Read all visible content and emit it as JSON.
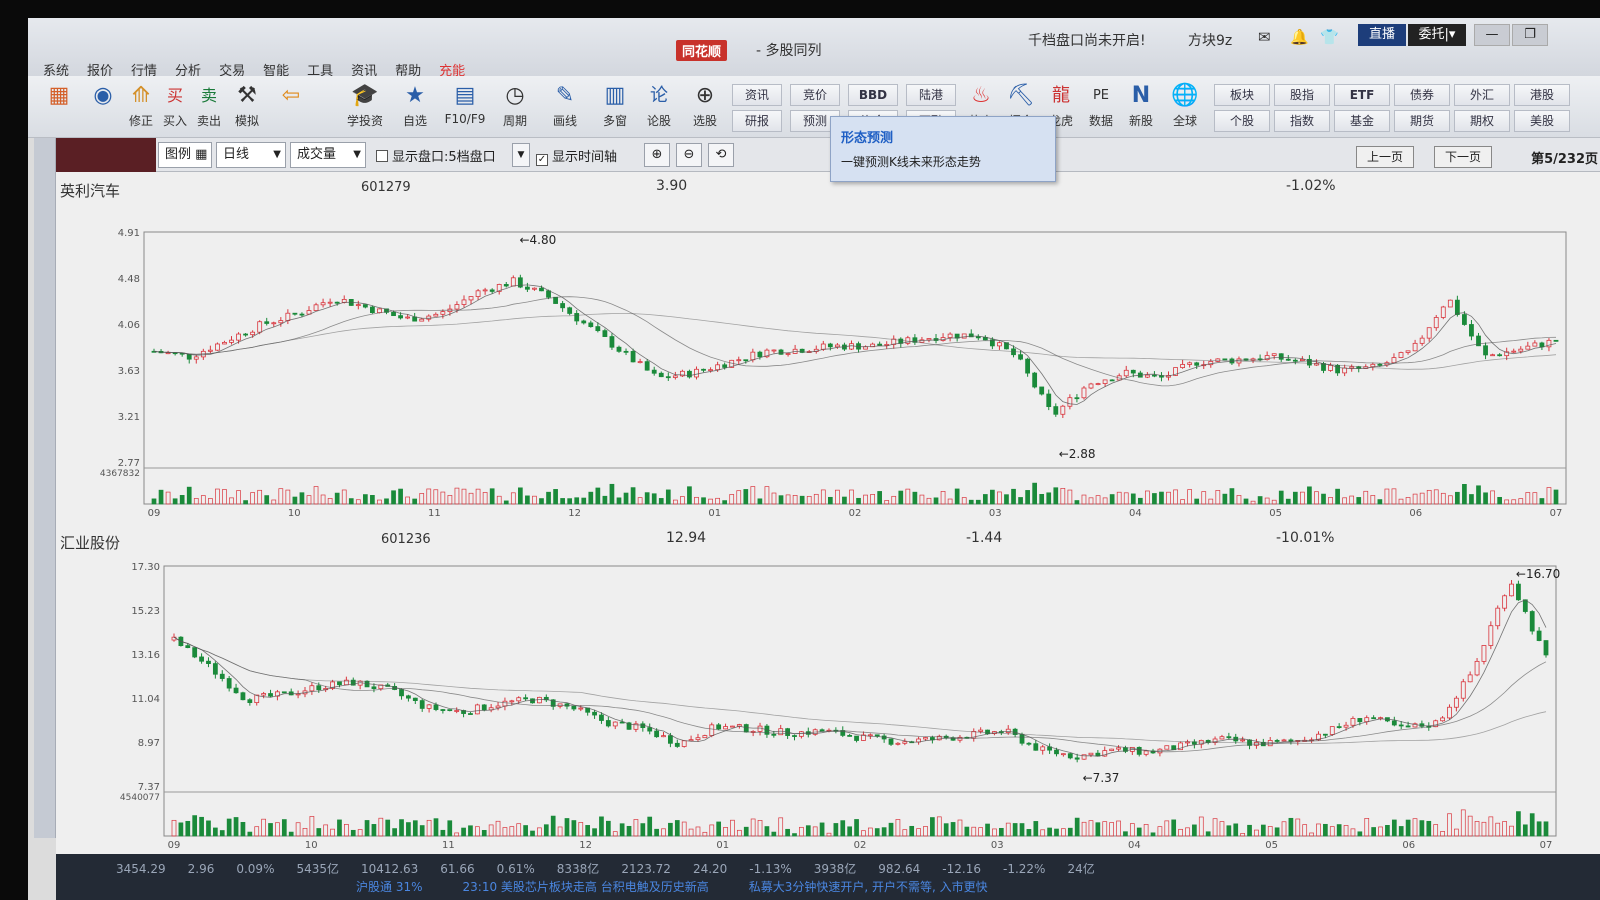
{
  "title_bar": {
    "app_logo": "同花顺",
    "window_title": "- 多股同列",
    "market_notice": "千档盘口尚未开启!",
    "user": "方块9z",
    "live_label": "直播",
    "order_label": "委托|▾",
    "min_label": "—",
    "restore_label": "❐"
  },
  "menu": [
    "系统",
    "报价",
    "行情",
    "分析",
    "交易",
    "智能",
    "工具",
    "资讯",
    "帮助",
    "充能"
  ],
  "toolbar": {
    "tools": [
      {
        "label": "",
        "icon": "▦"
      },
      {
        "label": "",
        "icon": "◉"
      },
      {
        "label": "修正",
        "icon": "⟰"
      },
      {
        "label": "买入",
        "icon": "买"
      },
      {
        "label": "卖出",
        "icon": "卖"
      },
      {
        "label": "模拟",
        "icon": "⚒"
      },
      {
        "label": "",
        "icon": "⇦"
      },
      {
        "label": "学投资",
        "icon": "🎓"
      },
      {
        "label": "自选",
        "icon": "★"
      },
      {
        "label": "F10/F9",
        "icon": "▤"
      },
      {
        "label": "周期",
        "icon": "◷"
      },
      {
        "label": "画线",
        "icon": "✎"
      },
      {
        "label": "多窗",
        "icon": "▥"
      },
      {
        "label": "论股",
        "icon": "论"
      },
      {
        "label": "选股",
        "icon": "⊕"
      }
    ],
    "small_buttons_top": [
      "资讯",
      "竞价",
      "BBD",
      "陆港"
    ],
    "small_buttons_bottom": [
      "研报",
      "预测",
      "资金",
      "两融"
    ],
    "icon_tools": [
      {
        "label": "热点",
        "icon": "♨"
      },
      {
        "label": "掘金",
        "icon": "⛏"
      },
      {
        "label": "龙虎",
        "icon": "龍"
      },
      {
        "label": "数据",
        "icon": "PE"
      },
      {
        "label": "新股",
        "icon": "N"
      },
      {
        "label": "全球",
        "icon": "🌐"
      }
    ],
    "right_buttons_top": [
      "板块",
      "股指",
      "ETF",
      "债券",
      "外汇",
      "港股"
    ],
    "right_buttons_bottom": [
      "个股",
      "指数",
      "基金",
      "期货",
      "期权",
      "美股"
    ]
  },
  "tooltip": {
    "title": "形态预测",
    "description": "一键预测K线未来形态走势"
  },
  "options_bar": {
    "legend_label": "图例 ▦",
    "period": "日线",
    "indicator": "成交量",
    "show_depth_label": "显示盘口:5档盘口",
    "show_depth_checked": false,
    "show_time_axis_label": "显示时间轴",
    "show_time_axis_checked": true,
    "prev_page": "上一页",
    "next_page": "下一页",
    "page_info": "第5/232页"
  },
  "charts": [
    {
      "name": "英利汽车",
      "code": "601279",
      "price": "3.90",
      "change": "",
      "change_pct": "-1.02%",
      "high_label": "4.80",
      "low_label": "2.88"
    },
    {
      "name": "汇业股份",
      "code": "601236",
      "price": "12.94",
      "change": "-1.44",
      "change_pct": "-10.01%",
      "high_label": "16.70",
      "low_label": "7.37"
    }
  ],
  "chart_data": [
    {
      "type": "candlestick",
      "title": "英利汽车",
      "y_ticks": [
        "4.91",
        "4.48",
        "4.06",
        "3.63",
        "3.21",
        "2.77"
      ],
      "ylim": [
        2.77,
        4.91
      ],
      "x_ticks": [
        "09",
        "10",
        "11",
        "12",
        "01",
        "02",
        "03",
        "04",
        "05",
        "06",
        "07"
      ],
      "close_trend": [
        3.8,
        3.75,
        3.9,
        4.05,
        4.15,
        4.3,
        4.2,
        4.1,
        4.15,
        4.35,
        4.45,
        4.3,
        4.05,
        3.8,
        3.55,
        3.6,
        3.7,
        3.8,
        3.82,
        3.85,
        3.85,
        3.9,
        3.95,
        3.95,
        3.75,
        3.2,
        3.5,
        3.6,
        3.55,
        3.7,
        3.72,
        3.75,
        3.7,
        3.62,
        3.65,
        3.8,
        4.3,
        3.75,
        3.82,
        3.9
      ],
      "volume_ticks": [
        "4367832"
      ],
      "markers": {
        "high": "4.80",
        "low": "2.88"
      }
    },
    {
      "type": "candlestick",
      "title": "汇业股份",
      "y_ticks": [
        "17.30",
        "15.23",
        "13.16",
        "11.04",
        "8.97",
        "7.37"
      ],
      "ylim": [
        6.9,
        17.3
      ],
      "x_ticks": [
        "09",
        "10",
        "11",
        "12",
        "01",
        "02",
        "03",
        "04",
        "05",
        "06",
        "07"
      ],
      "close_trend": [
        13.8,
        12.5,
        11.0,
        11.2,
        11.6,
        11.8,
        11.4,
        10.6,
        10.4,
        10.8,
        11.0,
        10.6,
        9.9,
        9.6,
        8.9,
        9.7,
        9.6,
        9.4,
        9.5,
        9.2,
        9.0,
        9.1,
        9.3,
        9.5,
        8.6,
        8.3,
        8.6,
        8.5,
        8.8,
        9.1,
        8.9,
        9.0,
        9.5,
        10.2,
        9.6,
        9.9,
        12.4,
        16.7,
        12.94
      ],
      "volume_ticks": [
        "4540077"
      ],
      "markers": {
        "high": "16.70",
        "low": "7.37"
      }
    }
  ],
  "status_bar": {
    "row1": [
      "3454.29",
      "2.96",
      "0.09%",
      "5435亿",
      "10412.63",
      "61.66",
      "0.61%",
      "8338亿",
      "2123.72",
      "24.20",
      "-1.13%",
      "3938亿",
      "982.64",
      "-12.16",
      "-1.22%",
      "24亿"
    ],
    "row2": [
      "沪股通 31%",
      "23:10 美股芯片板块走高 台积电触及历史新高",
      "私募大3分钟快速开户, 开户不需等, 入市更快"
    ]
  },
  "colors": {
    "up": "#d9363e",
    "down": "#1a8a3a",
    "ma": "#555555",
    "panel_bg": "#efefef",
    "tooltip_title": "#1f5fc4"
  }
}
